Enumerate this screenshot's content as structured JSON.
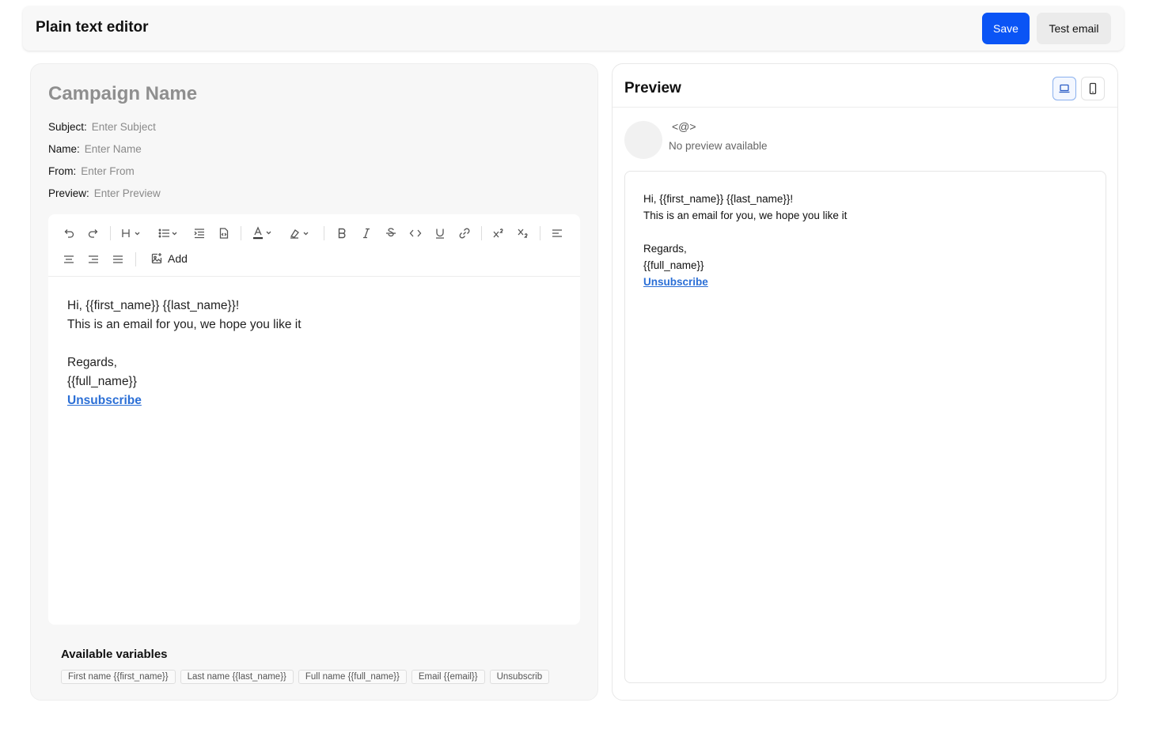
{
  "header": {
    "title": "Plain text editor",
    "save_label": "Save",
    "test_email_label": "Test email"
  },
  "campaign": {
    "name_placeholder": "Campaign Name",
    "fields": [
      {
        "label": "Subject:",
        "placeholder": "Enter Subject"
      },
      {
        "label": "Name:",
        "placeholder": "Enter Name"
      },
      {
        "label": "From:",
        "placeholder": "Enter From"
      },
      {
        "label": "Preview:",
        "placeholder": "Enter Preview"
      }
    ]
  },
  "toolbar": {
    "add_label": "Add",
    "icons": [
      "undo-icon",
      "redo-icon",
      "heading-icon",
      "bullet-list-icon",
      "indent-icon",
      "embed-icon",
      "text-color-icon",
      "highlight-icon",
      "bold-icon",
      "italic-icon",
      "strikethrough-icon",
      "code-icon",
      "underline-icon",
      "link-icon",
      "superscript-icon",
      "subscript-icon",
      "align-left-icon",
      "align-center-icon",
      "align-right-icon",
      "align-justify-icon",
      "image-add-icon"
    ]
  },
  "editor": {
    "line1": "Hi, {{first_name}} {{last_name}}!",
    "line2": "This is an email for you, we hope you like it",
    "line3": "Regards,",
    "line4": "{{full_name}}",
    "link": "Unsubscribe"
  },
  "variables": {
    "title": "Available variables",
    "chips": [
      "First name {{first_name}}",
      "Last name {{last_name}}",
      "Full name {{full_name}}",
      "Email {{email}}",
      "Unsubscrib"
    ]
  },
  "preview": {
    "title": "Preview",
    "sender": "<@>",
    "no_preview": "No preview available",
    "line1": "Hi, {{first_name}} {{last_name}}!",
    "line2": "This is an email for you, we hope you like it",
    "line3": "Regards,",
    "line4": "{{full_name}}",
    "link": "Unsubscribe"
  },
  "colors": {
    "primary": "#0a54f5",
    "link": "#2b6fd6"
  }
}
